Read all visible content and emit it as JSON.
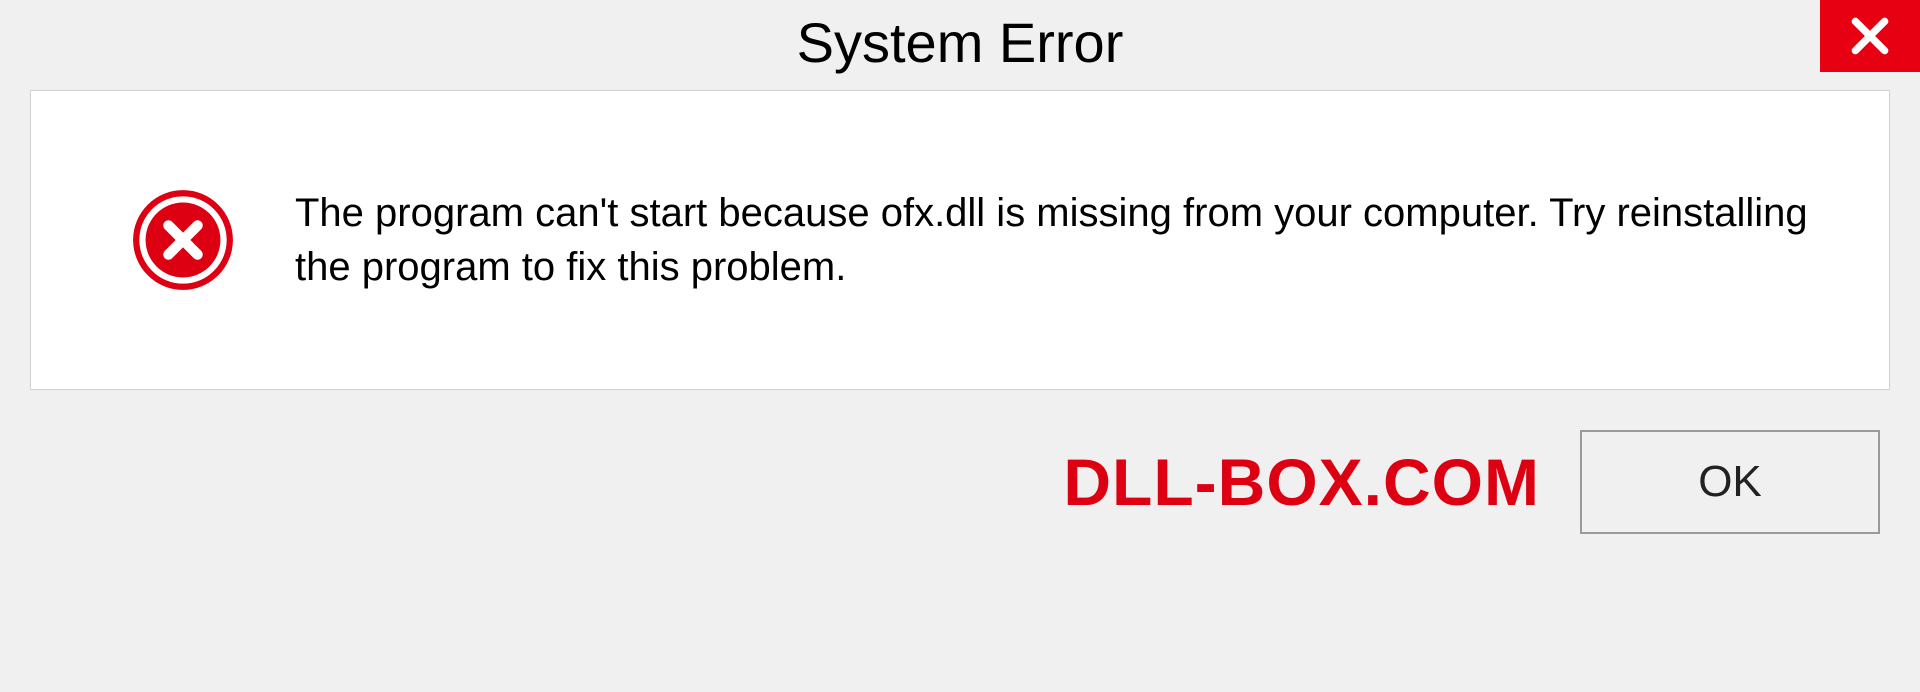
{
  "title": "System Error",
  "message": "The program can't start because ofx.dll is missing from your computer. Try reinstalling the program to fix this problem.",
  "watermark": "DLL-BOX.COM",
  "ok_label": "OK",
  "colors": {
    "close_bg": "#e60012",
    "error_icon": "#dc0012",
    "watermark": "#dc0012"
  }
}
